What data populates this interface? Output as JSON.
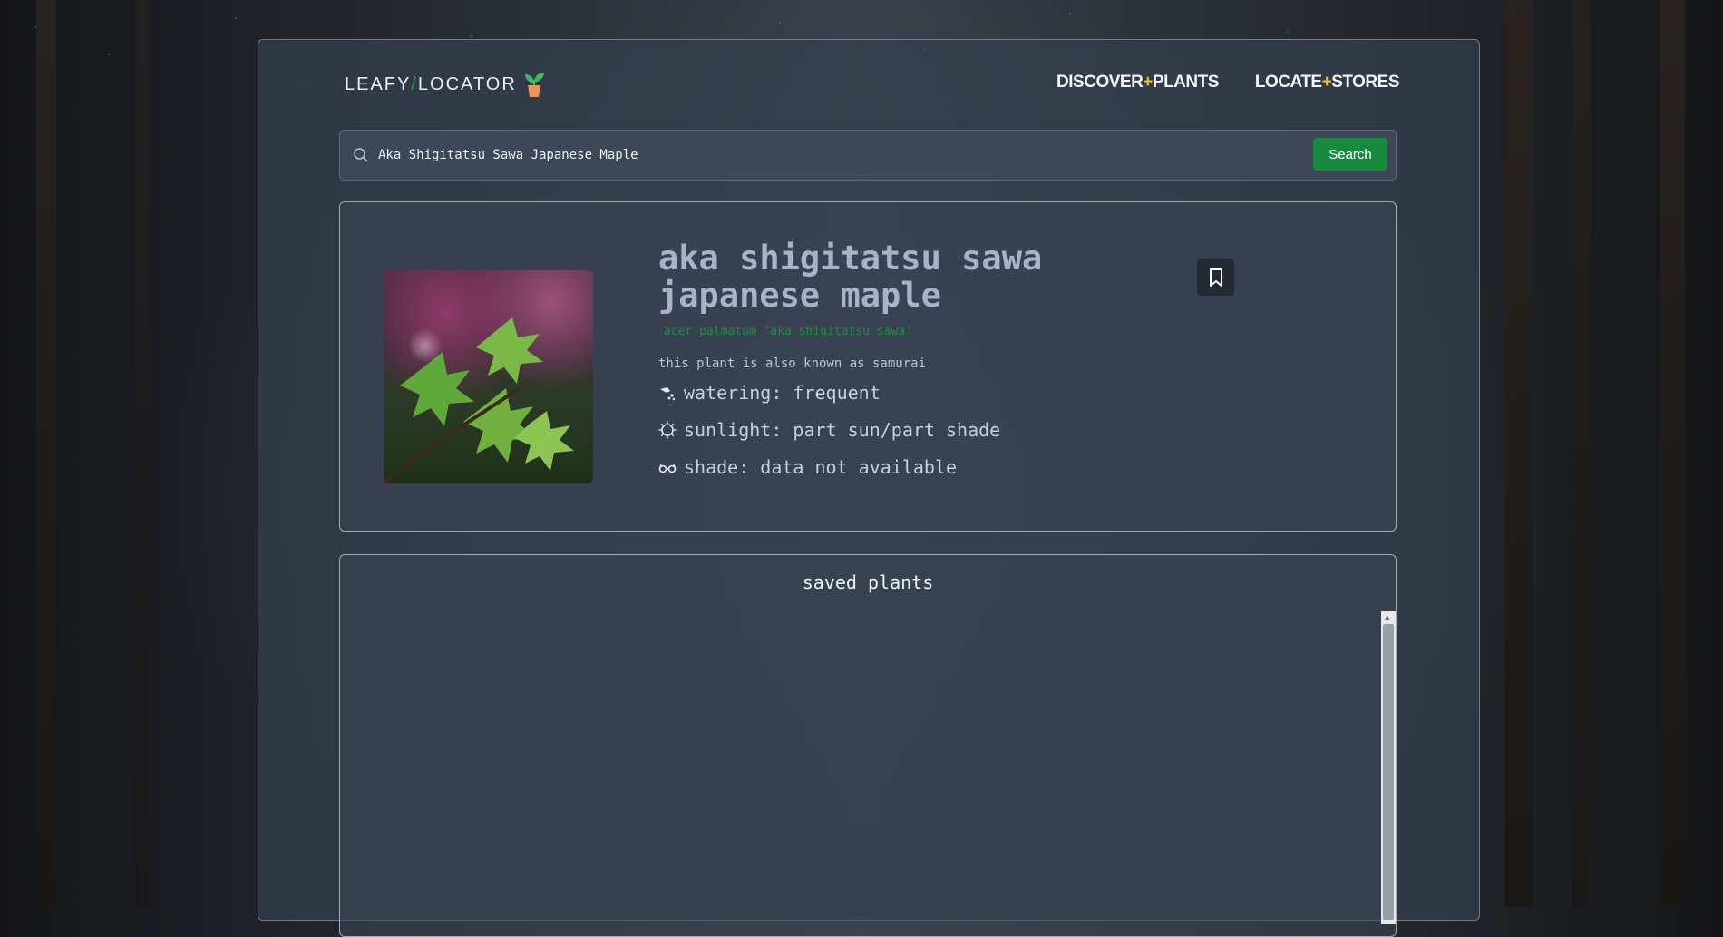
{
  "header": {
    "logo": {
      "part1": "LEAFY",
      "slash": "/",
      "part2": "LOCATOR"
    },
    "nav": [
      {
        "left": "DISCOVER",
        "plus": "+",
        "right": "PLANTS"
      },
      {
        "left": "LOCATE",
        "plus": "+",
        "right": "STORES"
      }
    ]
  },
  "search": {
    "value": "Aka Shigitatsu Sawa Japanese Maple",
    "button_label": "Search"
  },
  "plant": {
    "title": "aka shigitatsu sawa japanese maple",
    "scientific_name": "acer palmatum 'aka shigitatsu sawa'",
    "aka_text": "this plant is also known as samurai",
    "watering": "watering: frequent",
    "sunlight": "sunlight: part sun/part shade",
    "shade": "shade: data not available"
  },
  "saved": {
    "title": "saved plants"
  },
  "colors": {
    "accent_green": "#178a3d",
    "plus_yellow": "#f5b81f",
    "sci_green": "#1f8c3f"
  },
  "icons": [
    "plant-pot-icon",
    "search-icon",
    "bookmark-icon",
    "watering-icon",
    "sun-icon",
    "sunglasses-icon"
  ]
}
